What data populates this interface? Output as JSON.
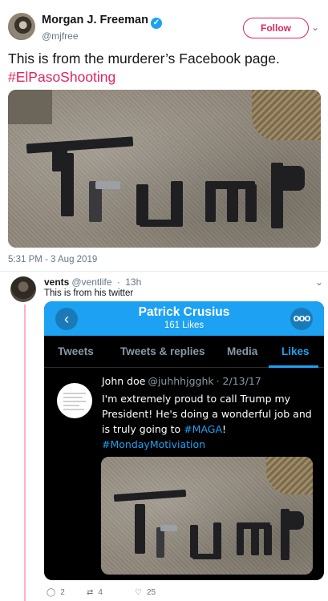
{
  "tweet": {
    "author_name": "Morgan J. Freeman",
    "author_handle": "@mjfree",
    "follow_label": "Follow",
    "text": "This is from the murderer’s Facebook page.",
    "hashtag": "#ElPasoShooting",
    "timestamp": "5:31 PM - 3 Aug 2019",
    "image_overlay_text": "Trump",
    "icons": {
      "verified": "verified-badge-icon",
      "caret": "chevron-down-icon"
    }
  },
  "reply": {
    "author_name": "vents",
    "author_handle": "@ventlife",
    "time": "13h",
    "text": "This is from his twitter",
    "actions": {
      "reply_count": "2",
      "retweet_count": "4",
      "like_count": "25"
    },
    "icons": {
      "reply": "reply-icon",
      "retweet": "retweet-icon",
      "like": "heart-icon"
    }
  },
  "screenshot": {
    "profile_name": "Patrick Crusius",
    "profile_likes": "161 Likes",
    "tabs": [
      "Tweets",
      "Tweets & replies",
      "Media",
      "Likes"
    ],
    "active_tab": "Likes",
    "liked_tweet": {
      "name": "John doe",
      "handle": "@juhhhjgghk",
      "date": "· 2/13/17",
      "text_before": "I'm extremely proud to call Trump my President! He's doing a wonderful job and is truly going to ",
      "hashtag1": "#MAGA",
      "text_after": "!",
      "hashtag2": "#MondayMotiviation",
      "image_overlay_text": "Trump"
    },
    "colors": {
      "header": "#1da1f2",
      "background": "#000000",
      "accent": "#1da1f2"
    }
  },
  "colors": {
    "hashtag": "#e0245e",
    "follow": "#e0245e",
    "thread_line": "#ffb0c8"
  }
}
